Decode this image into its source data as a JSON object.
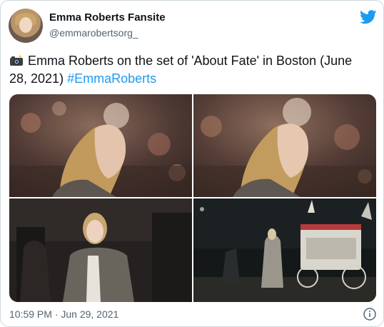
{
  "account": {
    "display_name": "Emma Roberts Fansite",
    "handle": "@emmarobertsorg_",
    "avatar_icon": "profile-photo"
  },
  "tweet": {
    "emoji_icon": "camera-with-flash-icon",
    "text": "Emma Roberts on the set of 'About Fate' in Boston (June 28, 2021) ",
    "hashtag": "#EmmaRoberts"
  },
  "media": [
    {
      "name": "set-photo-closeup-1"
    },
    {
      "name": "set-photo-closeup-2"
    },
    {
      "name": "set-photo-coat"
    },
    {
      "name": "set-photo-carriage"
    }
  ],
  "meta": {
    "timestamp": "10:59 PM · Jun 29, 2021"
  },
  "colors": {
    "link": "#1d9bf0",
    "text": "#0f1419",
    "secondary": "#536471",
    "twitter_blue": "#1d9bf0"
  }
}
